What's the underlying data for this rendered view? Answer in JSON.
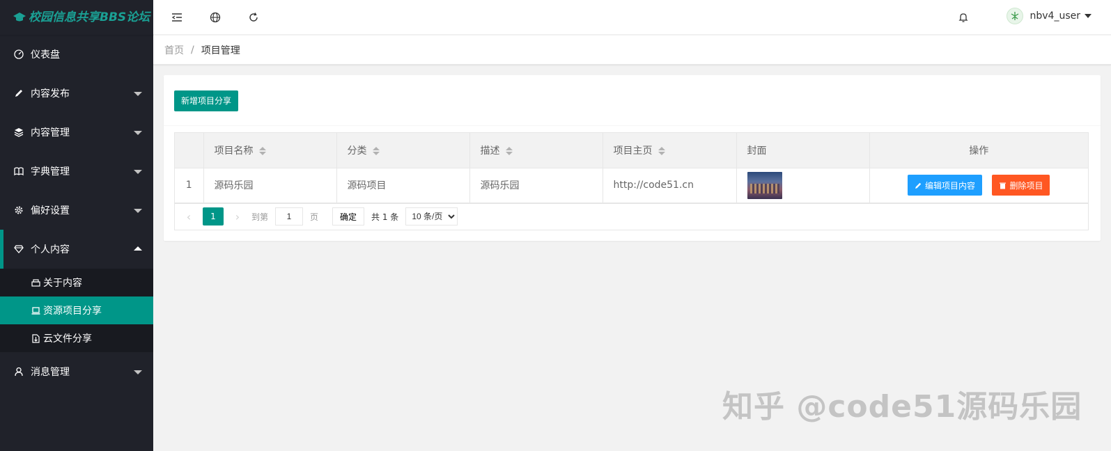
{
  "app": {
    "logo_text": "校园信息共享BBS论坛"
  },
  "sidebar": {
    "items": [
      {
        "label": "仪表盘",
        "icon": "dashboard-icon"
      },
      {
        "label": "内容发布",
        "icon": "pencil-icon"
      },
      {
        "label": "内容管理",
        "icon": "layers-icon"
      },
      {
        "label": "字典管理",
        "icon": "book-icon"
      },
      {
        "label": "偏好设置",
        "icon": "gear-icon"
      },
      {
        "label": "个人内容",
        "icon": "diamond-icon"
      }
    ],
    "sub_items": [
      {
        "label": "关于内容",
        "icon": "printer-icon"
      },
      {
        "label": "资源项目分享",
        "icon": "laptop-icon"
      },
      {
        "label": "云文件分享",
        "icon": "file-icon"
      }
    ],
    "last_item": {
      "label": "消息管理",
      "icon": "user-icon"
    }
  },
  "header": {
    "username": "nbv4_user"
  },
  "breadcrumb": {
    "home": "首页",
    "separator": "/",
    "current": "项目管理"
  },
  "toolbar": {
    "add_label": "新增项目分享"
  },
  "table": {
    "columns": [
      "项目名称",
      "分类",
      "描述",
      "项目主页",
      "封面",
      "操作"
    ],
    "rows": [
      {
        "index": "1",
        "name": "源码乐园",
        "category": "源码项目",
        "desc": "源码乐园",
        "homepage": "http://code51.cn"
      }
    ],
    "edit_label": "编辑项目内容",
    "delete_label": "删除项目"
  },
  "pager": {
    "current": "1",
    "goto_label": "到第",
    "page_value": "1",
    "page_unit": "页",
    "confirm": "确定",
    "total": "共 1 条",
    "per_page": "10 条/页"
  },
  "watermark": "知乎 @code51源码乐园",
  "colors": {
    "sidebar": "#20222a",
    "accent": "#009688",
    "edit": "#1e9fff",
    "delete": "#ff5722"
  }
}
